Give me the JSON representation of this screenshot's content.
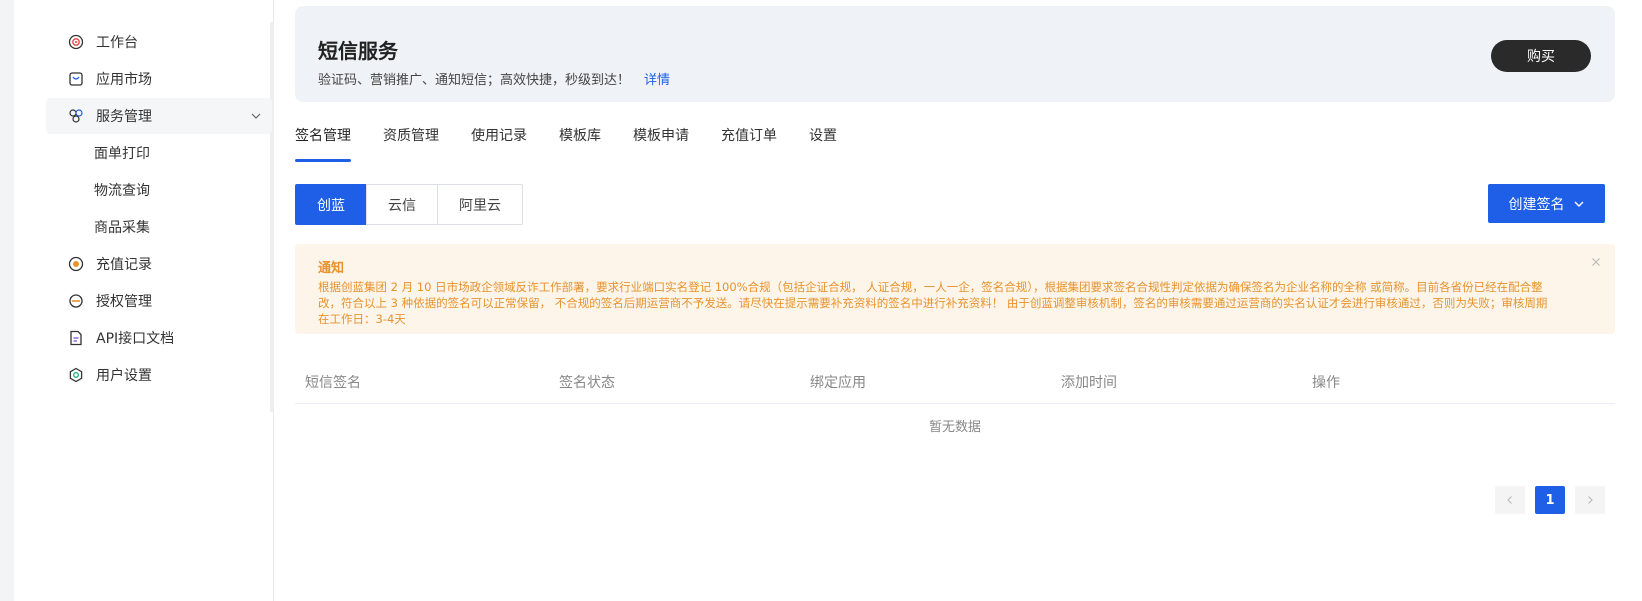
{
  "sidebar": {
    "items": [
      {
        "label": "工作台",
        "icon": "target-icon"
      },
      {
        "label": "应用市场",
        "icon": "market-icon"
      },
      {
        "label": "服务管理",
        "icon": "service-icon"
      },
      {
        "label": "面单打印"
      },
      {
        "label": "物流查询"
      },
      {
        "label": "商品采集"
      },
      {
        "label": "充值记录",
        "icon": "coin-icon"
      },
      {
        "label": "授权管理",
        "icon": "authorize-icon"
      },
      {
        "label": "API接口文档",
        "icon": "document-icon"
      },
      {
        "label": "用户设置",
        "icon": "settings-icon"
      }
    ]
  },
  "banner": {
    "title": "短信服务",
    "desc": "验证码、营销推广、通知短信；高效快捷，秒级到达！",
    "link": "详情",
    "buy": "购买"
  },
  "tabs": [
    "签名管理",
    "资质管理",
    "使用记录",
    "模板库",
    "模板申请",
    "充值订单",
    "设置"
  ],
  "providers": [
    "创蓝",
    "云信",
    "阿里云"
  ],
  "create_button": "创建签名",
  "notice": {
    "title": "通知",
    "body": "根据创蓝集团 2 月 10 日市场政企领域反诈工作部署，要求行业端口实名登记 100%合规（包括企证合规， 人证合规，一人一企，签名合规），根据集团要求签名合规性判定依据为确保签名为企业名称的全称 或简称。目前各省份已经在配合整改，符合以上 3 种依据的签名可以正常保留， 不合规的签名后期运营商不予发送。请尽快在提示需要补充资料的签名中进行补充资料！ 由于创蓝调整审核机制，签名的审核需要通过运营商的实名认证才会进行审核通过，否则为失败；审核周期在工作日：3-4天"
  },
  "table": {
    "columns": [
      "短信签名",
      "签名状态",
      "绑定应用",
      "添加时间",
      "操作"
    ],
    "empty": "暂无数据"
  },
  "pagination": {
    "current": "1"
  },
  "colors": {
    "primary": "#1f5fe8",
    "notice": "#e8932c",
    "dark_button": "#2a2a2a"
  }
}
